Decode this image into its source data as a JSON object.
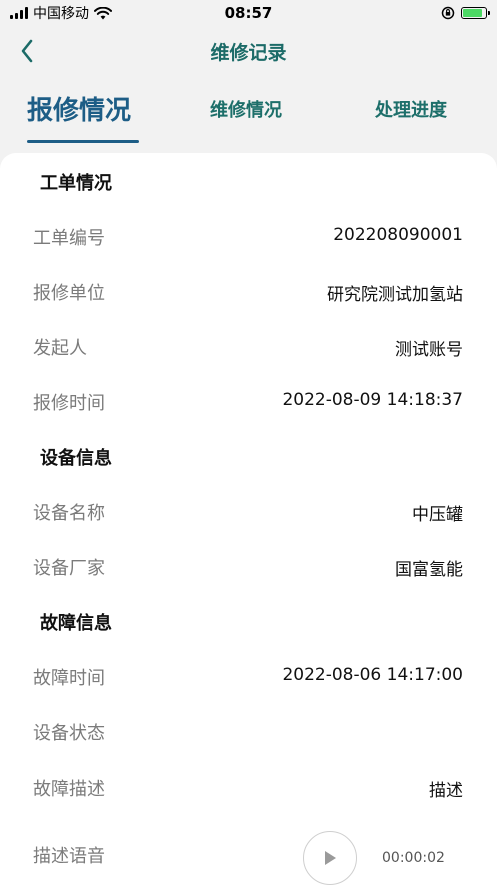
{
  "status_bar": {
    "carrier": "中国移动",
    "time": "08:57",
    "battery_level": 0.85
  },
  "nav": {
    "title": "维修记录",
    "back_icon": "chevron-left-icon"
  },
  "tabs": [
    {
      "label": "报修情况",
      "active": true
    },
    {
      "label": "维修情况",
      "active": false
    },
    {
      "label": "处理进度",
      "active": false
    }
  ],
  "sections": {
    "work_order": {
      "title": "工单情况",
      "rows": [
        {
          "label": "工单编号",
          "value": "202208090001"
        },
        {
          "label": "报修单位",
          "value": "研究院测试加氢站"
        },
        {
          "label": "发起人",
          "value": "测试账号"
        },
        {
          "label": "报修时间",
          "value": "2022-08-09 14:18:37"
        }
      ]
    },
    "device": {
      "title": "设备信息",
      "rows": [
        {
          "label": "设备名称",
          "value": "中压罐"
        },
        {
          "label": "设备厂家",
          "value": "国富氢能"
        }
      ]
    },
    "fault": {
      "title": "故障信息",
      "rows": [
        {
          "label": "故障时间",
          "value": "2022-08-06 14:17:00"
        },
        {
          "label": "设备状态",
          "value": ""
        },
        {
          "label": "故障描述",
          "value": "描述"
        }
      ]
    }
  },
  "voice": {
    "label": "描述语音",
    "duration": "00:00:02"
  },
  "colors": {
    "accent": "#1d5d86",
    "teal": "#1c6b68",
    "label_gray": "#7b7b7b",
    "battery_green": "#4cd964"
  }
}
